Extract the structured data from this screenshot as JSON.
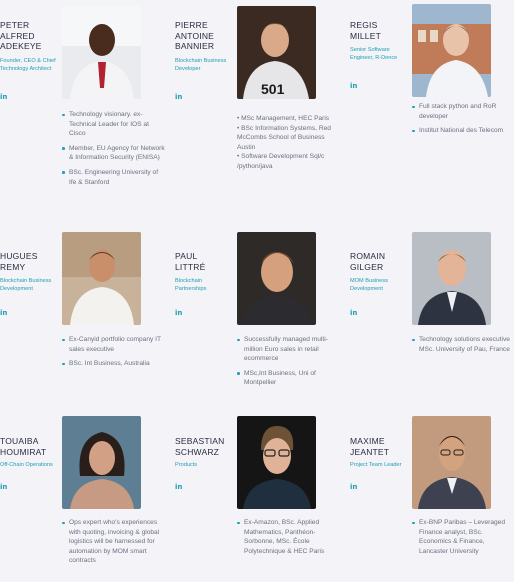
{
  "team": [
    {
      "name_lines": [
        "PETER",
        "ALFRED",
        "ADEKEYE"
      ],
      "role_lines": [
        "Founder, CEO & Chief",
        "Technology Architect"
      ],
      "linkedin": "in",
      "bullets": [
        "Technology visionary. ex-Technical Leader for IOS at Cisco",
        "Member, EU Agency for Network & Information Security (ENISA)",
        "BSc. Engineering University of Ife & Stanford"
      ]
    },
    {
      "name_lines": [
        "PIERRE",
        "ANTOINE",
        "BANNIER"
      ],
      "role_lines": [
        "Blockchain Business",
        "Developer"
      ],
      "linkedin": "in",
      "bullets": [
        "• MSc Management, HEC Paris",
        "• BSc Information Systems, Red McCombs School of Business Austin",
        "• Software Development Sql/c /python/java"
      ]
    },
    {
      "name_lines": [
        "REGIS",
        "MILLET"
      ],
      "role_lines": [
        "Senior Software",
        "Engineer, R-Dence"
      ],
      "linkedin": "in",
      "bullets": [
        "Full stack python and RoR developer",
        "Institut National des Telecom"
      ]
    },
    {
      "name_lines": [
        "HUGUES",
        "REMY"
      ],
      "role_lines": [
        "Blockchain Business",
        "Development"
      ],
      "linkedin": "in",
      "bullets": [
        "Ex-Canyid portfolio company IT sales executive",
        "BSc. Int Business, Australia"
      ]
    },
    {
      "name_lines": [
        "PAUL",
        "LITTRÉ"
      ],
      "role_lines": [
        "Blockchain",
        "Partnerships"
      ],
      "linkedin": "in",
      "bullets": [
        "Successfully managed multi-million Euro sales in retail ecommerce",
        "MSc,Int Business, Uni of Montpellier"
      ]
    },
    {
      "name_lines": [
        "ROMAIN",
        "GILGER"
      ],
      "role_lines": [
        "MOM Business",
        "Development"
      ],
      "linkedin": "in",
      "bullets": [
        "Technology solutions executive MSc. University of Pau, France"
      ]
    },
    {
      "name_lines": [
        "TOUAIBA",
        "HOUMIRAT"
      ],
      "role_lines": [
        "Off-Chain Operations"
      ],
      "linkedin": "in",
      "bullets": [
        "Ops expert who's experiences with quoting, invoicing & global logistics will be harnessed for automation by MOM smart contracts"
      ]
    },
    {
      "name_lines": [
        "SEBASTIAN",
        "SCHWARZ"
      ],
      "role_lines": [
        "Products"
      ],
      "linkedin": "in",
      "bullets": [
        "Ex-Amazon, BSc. Applied Mathematics, Panthéon-Sorbonne, MSc. École Polytechnique & HEC Paris"
      ]
    },
    {
      "name_lines": [
        "MAXIME",
        "JEANTET"
      ],
      "role_lines": [
        "Project Team Leader"
      ],
      "linkedin": "in",
      "bullets": [
        "Ex-BNP Paribas – Leveraged Finance analyst, BSc. Economics & Finance, Lancaster University"
      ]
    }
  ]
}
